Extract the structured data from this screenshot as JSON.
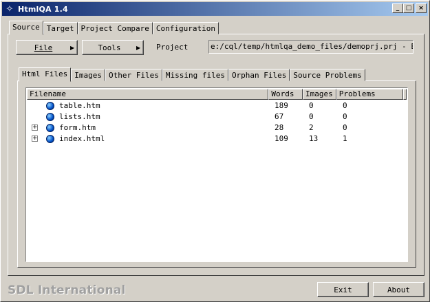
{
  "window": {
    "title": "HtmlQA 1.4",
    "minimize": "_",
    "maximize": "□",
    "close": "×"
  },
  "main_tabs": [
    {
      "label": "Source",
      "active": true
    },
    {
      "label": "Target",
      "active": false
    },
    {
      "label": "Project Compare",
      "active": false
    },
    {
      "label": "Configuration",
      "active": false
    }
  ],
  "toolbar": {
    "file_label": "File",
    "tools_label": "Tools",
    "project_label": "Project",
    "project_path": "e:/cql/temp/htmlqa_demo_files/demoprj.prj - EN-US"
  },
  "inner_tabs": [
    {
      "label": "Html Files",
      "active": true
    },
    {
      "label": "Images",
      "active": false
    },
    {
      "label": "Other Files",
      "active": false
    },
    {
      "label": "Missing files",
      "active": false
    },
    {
      "label": "Orphan Files",
      "active": false
    },
    {
      "label": "Source Problems",
      "active": false
    }
  ],
  "grid": {
    "columns": [
      "Filename",
      "Words",
      "Images",
      "Problems"
    ],
    "rows": [
      {
        "filename": "table.htm",
        "words": "189",
        "images": "0",
        "problems": "0",
        "expandable": false
      },
      {
        "filename": "lists.htm",
        "words": "67",
        "images": "0",
        "problems": "0",
        "expandable": false
      },
      {
        "filename": "form.htm",
        "words": "28",
        "images": "2",
        "problems": "0",
        "expandable": true
      },
      {
        "filename": "index.html",
        "words": "109",
        "images": "13",
        "problems": "1",
        "expandable": true
      }
    ]
  },
  "footer": {
    "brand": "SDL International",
    "exit_label": "Exit",
    "about_label": "About"
  }
}
